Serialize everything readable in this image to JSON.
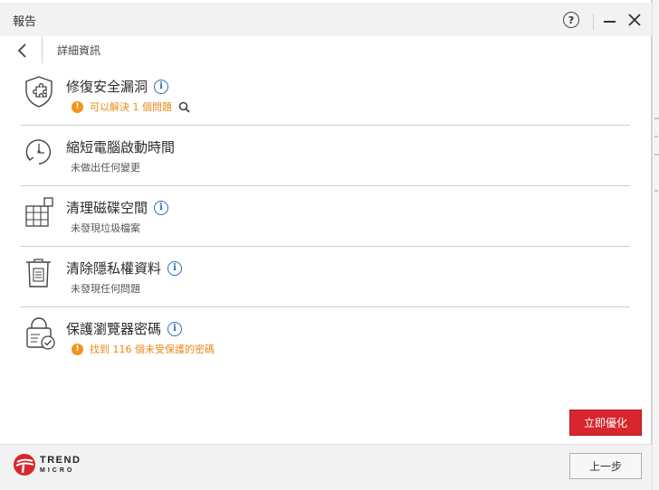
{
  "window": {
    "title": "報告",
    "help_icon": "question-circle-icon",
    "help_glyph": "?",
    "minimize_icon": "minimize-icon",
    "close_icon": "close-icon"
  },
  "header": {
    "back_icon": "chevron-left-icon",
    "title": "詳細資訊"
  },
  "items": [
    {
      "icon": "shield-puzzle-icon",
      "title": "修復安全漏洞",
      "has_info": true,
      "status": "可以解決 1 個問題",
      "status_type": "warning",
      "has_search": true
    },
    {
      "icon": "clock-startup-icon",
      "title": "縮短電腦啟動時間",
      "has_info": false,
      "status": "未做出任何變更",
      "status_type": "normal",
      "has_search": false
    },
    {
      "icon": "disk-grid-icon",
      "title": "清理磁碟空間",
      "has_info": true,
      "status": "未發現垃圾檔案",
      "status_type": "normal",
      "has_search": false
    },
    {
      "icon": "trash-document-icon",
      "title": "清除隱私權資料",
      "has_info": true,
      "status": "未發現任何問題",
      "status_type": "normal",
      "has_search": false
    },
    {
      "icon": "lock-check-icon",
      "title": "保護瀏覽器密碼",
      "has_info": true,
      "status": "找到 116 個未受保護的密碼",
      "status_type": "warning",
      "has_search": false
    }
  ],
  "glyphs": {
    "info": "i",
    "warning": "!"
  },
  "actions": {
    "optimize_label": "立即優化",
    "previous_label": "上一步"
  },
  "brand": {
    "line1": "TREND",
    "line2": "MICRO",
    "color": "#d7262e"
  },
  "colors": {
    "accent_red": "#d7262e",
    "warning_orange": "#e8891a",
    "info_blue": "#2b6fb5"
  }
}
